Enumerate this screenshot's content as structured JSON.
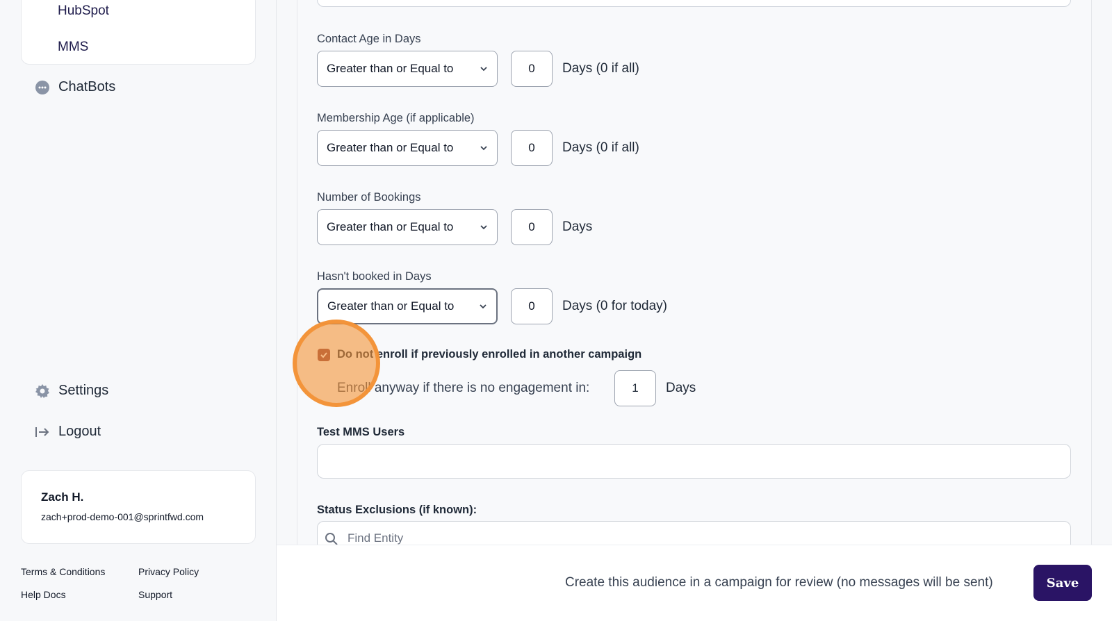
{
  "sidebar": {
    "sub_items": [
      {
        "label": "HubSpot"
      },
      {
        "label": "MMS"
      }
    ],
    "chatbots_label": "ChatBots",
    "settings_label": "Settings",
    "logout_label": "Logout",
    "user": {
      "name": "Zach H.",
      "email": "zach+prod-demo-001@sprintfwd.com"
    },
    "footer": {
      "terms": "Terms & Conditions",
      "privacy": "Privacy Policy",
      "help": "Help Docs",
      "support": "Support"
    }
  },
  "form": {
    "contact_age": {
      "label": "Contact Age in Days",
      "operator": "Greater than or Equal to",
      "value": "0",
      "unit": "Days (0 if all)"
    },
    "membership_age": {
      "label": "Membership Age (if applicable)",
      "operator": "Greater than or Equal to",
      "value": "0",
      "unit": "Days (0 if all)"
    },
    "bookings": {
      "label": "Number of Bookings",
      "operator": "Greater than or Equal to",
      "value": "0",
      "unit": "Days"
    },
    "not_booked": {
      "label": "Hasn't booked in Days",
      "operator": "Greater than or Equal to",
      "value": "0",
      "unit": "Days (0 for today)"
    },
    "no_reenroll": {
      "label": "Do not enroll if previously enrolled in another campaign",
      "checked": true
    },
    "enroll_anyway": {
      "label": "Enroll anyway if there is no engagement in:",
      "value": "1",
      "unit": "Days"
    },
    "test_users": {
      "label": "Test MMS Users",
      "value": ""
    },
    "status_exclusions": {
      "label": "Status Exclusions (if known):",
      "placeholder": "Find Entity"
    }
  },
  "bottom_bar": {
    "description": "Create this audience in a campaign for review (no messages will be sent)",
    "save_label": "Save"
  },
  "colors": {
    "primary_button": "#2a1465",
    "checkbox": "#8b3a3a",
    "highlight": "#f39237"
  }
}
